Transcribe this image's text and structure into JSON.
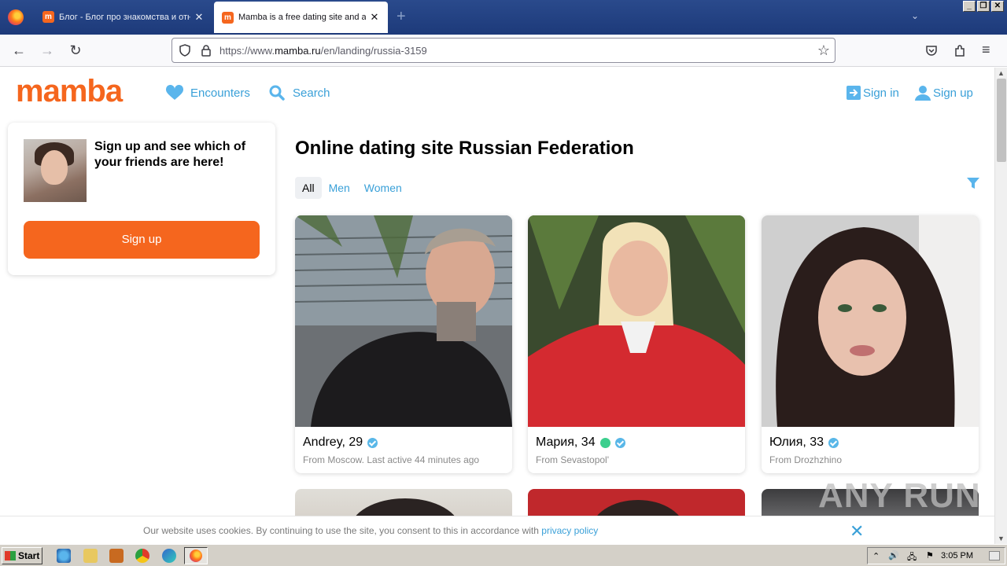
{
  "browser": {
    "tabs": [
      {
        "title": "Блог - Блог про знакомства и отн",
        "active": false
      },
      {
        "title": "Mamba is a free dating site and a d",
        "active": true
      }
    ],
    "url_prefix": "https://www.",
    "url_domain": "mamba.ru",
    "url_path": "/en/landing/russia-3159"
  },
  "site": {
    "logo": "mamba",
    "nav": {
      "encounters": "Encounters",
      "search": "Search",
      "sign_in": "Sign in",
      "sign_up": "Sign up"
    },
    "accent_color": "#f5661e",
    "link_color": "#3aa0d8"
  },
  "promo": {
    "text": "Sign up and see which of your friends are here!",
    "button": "Sign up"
  },
  "main": {
    "title": "Online dating site Russian Federation",
    "filters": [
      "All",
      "Men",
      "Women"
    ],
    "selected_filter": "All"
  },
  "profiles": [
    {
      "name": "Andrey, 29",
      "sub": "From Moscow. Last active 44 minutes ago",
      "verified": true,
      "online": false
    },
    {
      "name": "Мария, 34",
      "sub": "From Sevastopol'",
      "verified": true,
      "online": true
    },
    {
      "name": "Юлия, 33",
      "sub": "From Drozhzhino",
      "verified": true,
      "online": false
    }
  ],
  "cookie": {
    "text": "Our website uses cookies. By continuing to use the site, you consent to this in accordance with ",
    "link": "privacy policy"
  },
  "watermark": "ANY RUN",
  "taskbar": {
    "start": "Start",
    "clock": "3:05 PM"
  }
}
